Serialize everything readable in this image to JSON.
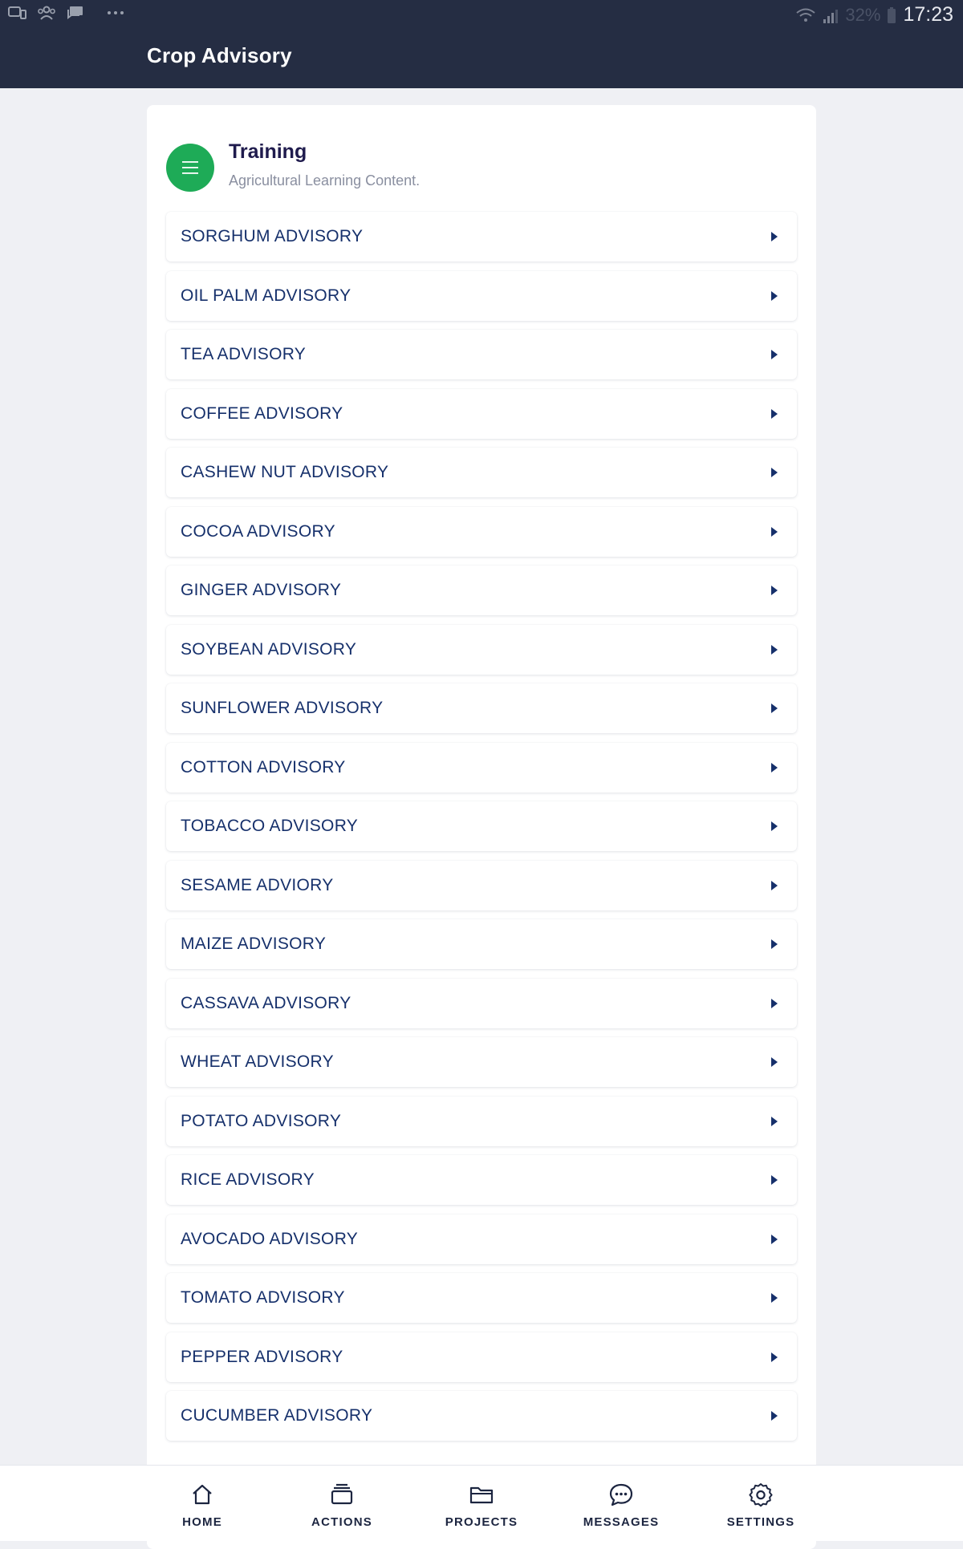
{
  "status_bar": {
    "time": "17:23",
    "battery": "32%",
    "icons": [
      "notification-icon",
      "group-icon",
      "chat-icon",
      "more-icon",
      "wifi-icon",
      "signal-icon",
      "battery-icon"
    ]
  },
  "app_bar": {
    "title": "Crop Advisory"
  },
  "section": {
    "title": "Training",
    "subtitle": "Agricultural Learning Content.",
    "icon": "menu-icon",
    "accent": "#1eab57"
  },
  "advisories": [
    {
      "label": "SORGHUM ADVISORY"
    },
    {
      "label": "OIL PALM ADVISORY"
    },
    {
      "label": "TEA ADVISORY"
    },
    {
      "label": "COFFEE ADVISORY"
    },
    {
      "label": "CASHEW NUT ADVISORY"
    },
    {
      "label": "COCOA ADVISORY"
    },
    {
      "label": "GINGER ADVISORY"
    },
    {
      "label": "SOYBEAN ADVISORY"
    },
    {
      "label": "SUNFLOWER ADVISORY"
    },
    {
      "label": "COTTON ADVISORY"
    },
    {
      "label": "TOBACCO ADVISORY"
    },
    {
      "label": "SESAME ADVIORY"
    },
    {
      "label": "MAIZE ADVISORY"
    },
    {
      "label": "CASSAVA ADVISORY"
    },
    {
      "label": "WHEAT ADVISORY"
    },
    {
      "label": "POTATO ADVISORY"
    },
    {
      "label": "RICE ADVISORY"
    },
    {
      "label": "AVOCADO ADVISORY"
    },
    {
      "label": "TOMATO ADVISORY"
    },
    {
      "label": "PEPPER ADVISORY"
    },
    {
      "label": "CUCUMBER ADVISORY"
    }
  ],
  "bottom_nav": [
    {
      "label": "HOME",
      "icon": "home-icon"
    },
    {
      "label": "ACTIONS",
      "icon": "stack-icon"
    },
    {
      "label": "PROJECTS",
      "icon": "folder-icon"
    },
    {
      "label": "MESSAGES",
      "icon": "chat-bubble-icon"
    },
    {
      "label": "SETTINGS",
      "icon": "gear-icon"
    }
  ],
  "colors": {
    "app_bar": "#252d43",
    "item_text": "#16306b",
    "background": "#eff0f4"
  }
}
